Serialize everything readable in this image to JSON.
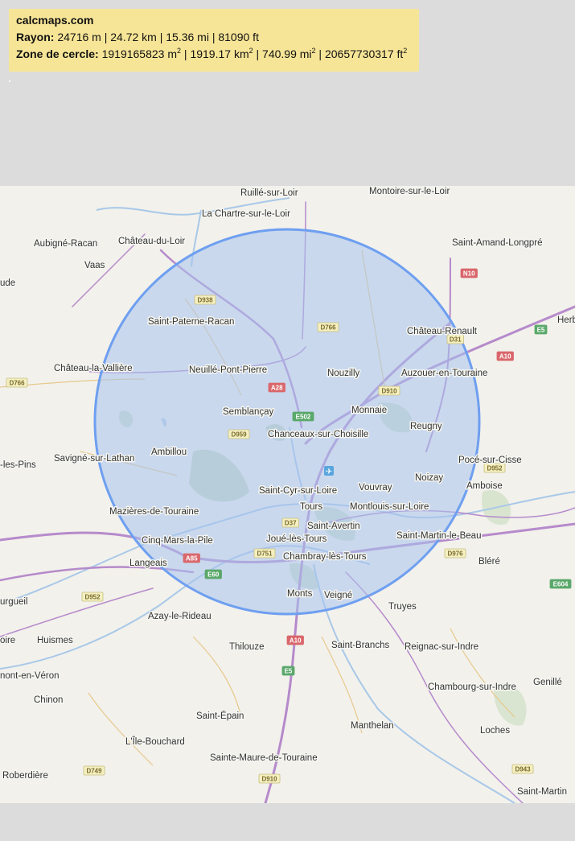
{
  "info": {
    "site": "calcmaps.com",
    "radius_label": "Rayon:",
    "radius_value": " 24716 m | 24.72 km | 15.36 mi | 81090 ft",
    "area_label": "Zone de cercle:",
    "area_m2": " 1919165823 m",
    "area_km2": " | 1919.17 km",
    "area_mi2": " | 740.99 mi",
    "area_ft2": " | 20657730317 ft",
    "sup": "2"
  },
  "map": {
    "circle": {
      "fill": "#a8c2ee",
      "stroke": "#6e9ff0"
    },
    "towns": [
      "Ruillé-sur-Loir",
      "Montoire-sur-le-Loir",
      "La Chartre-sur-le-Loir",
      "Aubigné-Racan",
      "Château-du-Loir",
      "Vaas",
      "Saint-Amand-Longpré",
      "ude",
      "Saint-Paterne-Racan",
      "Château-Renault",
      "Herb",
      "Château-la-Vallière",
      "Neuillé-Pont-Pierre",
      "Nouzilly",
      "Auzouer-en-Touraine",
      "Semblançay",
      "Monnaie",
      "Reugny",
      "Chanceaux-sur-Choisille",
      "Ambillou",
      "Savigné-sur-Lathan",
      "-les-Pins",
      "Pocé-sur-Cisse",
      "Noizay",
      "Vouvray",
      "Amboise",
      "Saint-Cyr-sur-Loire",
      "Tours",
      "Montlouis-sur-Loire",
      "Mazières-de-Touraine",
      "Saint-Avertin",
      "Cinq-Mars-la-Pile",
      "Joué-lès-Tours",
      "Saint-Martin-le-Beau",
      "Langeais",
      "Chambray-lès-Tours",
      "Bléré",
      "urgueil",
      "Monts",
      "Veigné",
      "Truyes",
      "Azay-le-Rideau",
      "oire",
      "Huismes",
      "Thilouze",
      "Saint-Branchs",
      "Reignac-sur-Indre",
      "nont-en-Véron",
      "Chambourg-sur-Indre",
      "Genillé",
      "Chinon",
      "Saint-Épain",
      "Manthelan",
      "Loches",
      "L'Île-Bouchard",
      "Sainte-Maure-de-Touraine",
      "Roberdière",
      "Saint-Martin"
    ],
    "road_badges": [
      "D938",
      "D766",
      "N10",
      "E5",
      "D31",
      "A10",
      "D766",
      "A28",
      "D910",
      "E502",
      "D959",
      "D952",
      "D37",
      "D751",
      "A85",
      "D976",
      "E60",
      "D952",
      "E604",
      "A10",
      "E5",
      "D749",
      "D910",
      "D943"
    ]
  }
}
